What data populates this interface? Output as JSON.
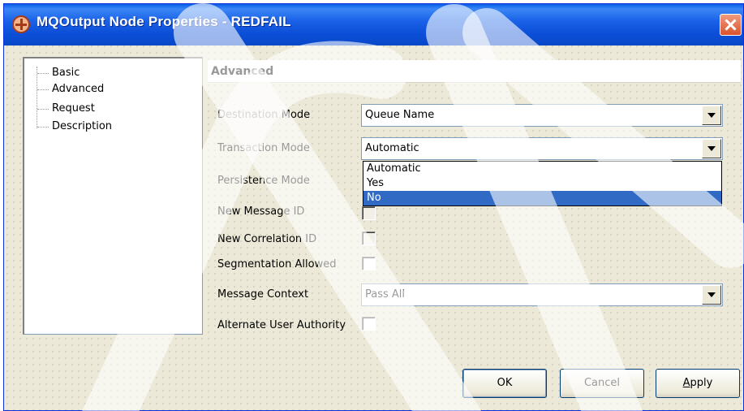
{
  "window": {
    "title": "MQOutput Node Properties - REDFAIL"
  },
  "nav": {
    "items": [
      {
        "label": "Basic"
      },
      {
        "label": "Advanced"
      },
      {
        "label": "Request"
      },
      {
        "label": "Description"
      }
    ]
  },
  "section": {
    "title": "Advanced"
  },
  "fields": {
    "destination_mode": {
      "label": "Destination Mode",
      "value": "Queue Name"
    },
    "transaction_mode": {
      "label": "Transaction Mode",
      "value": "Automatic",
      "options": [
        "Automatic",
        "Yes",
        "No"
      ],
      "highlighted": "No"
    },
    "persistence_mode": {
      "label": "Persistence Mode"
    },
    "new_message_id": {
      "label": "New Message ID",
      "checked": false
    },
    "new_correlation_id": {
      "label": "New Correlation ID",
      "checked": false
    },
    "segmentation_allowed": {
      "label": "Segmentation Allowed",
      "checked": false
    },
    "message_context": {
      "label": "Message Context",
      "value": "Pass All"
    },
    "alternate_user_authority": {
      "label": "Alternate User Authority",
      "checked": false
    }
  },
  "buttons": {
    "ok": "OK",
    "cancel": "Cancel",
    "apply": "Apply"
  },
  "colors": {
    "titlebar": "#0c4fd8",
    "selection": "#316ac5",
    "dialog_bg": "#ece9d8"
  }
}
